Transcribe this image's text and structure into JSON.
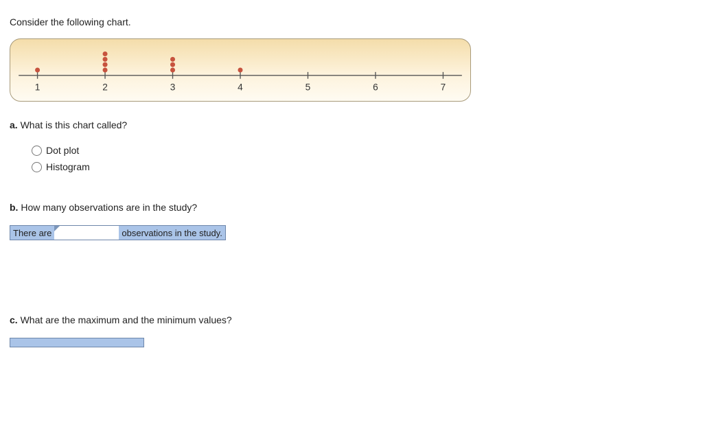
{
  "prompt": "Consider the following chart.",
  "chart_data": {
    "type": "dotplot",
    "axis_ticks": [
      1,
      2,
      3,
      4,
      5,
      6,
      7
    ],
    "counts": {
      "1": 1,
      "2": 4,
      "3": 3,
      "4": 1,
      "5": 0,
      "6": 0,
      "7": 0
    },
    "xlim": [
      0.5,
      7.5
    ],
    "dots_color": "#c7533e",
    "axis_color": "#555"
  },
  "qa": {
    "label_prefix": "a.",
    "text": " What is this chart called?",
    "options": [
      {
        "label": "Dot plot"
      },
      {
        "label": "Histogram"
      }
    ]
  },
  "qb": {
    "label_prefix": "b.",
    "text": " How many observations are in the study?",
    "fill_before": "There are",
    "fill_after": "observations in the study.",
    "value": ""
  },
  "qc": {
    "label_prefix": "c.",
    "text": " What are the maximum and the minimum values?"
  }
}
